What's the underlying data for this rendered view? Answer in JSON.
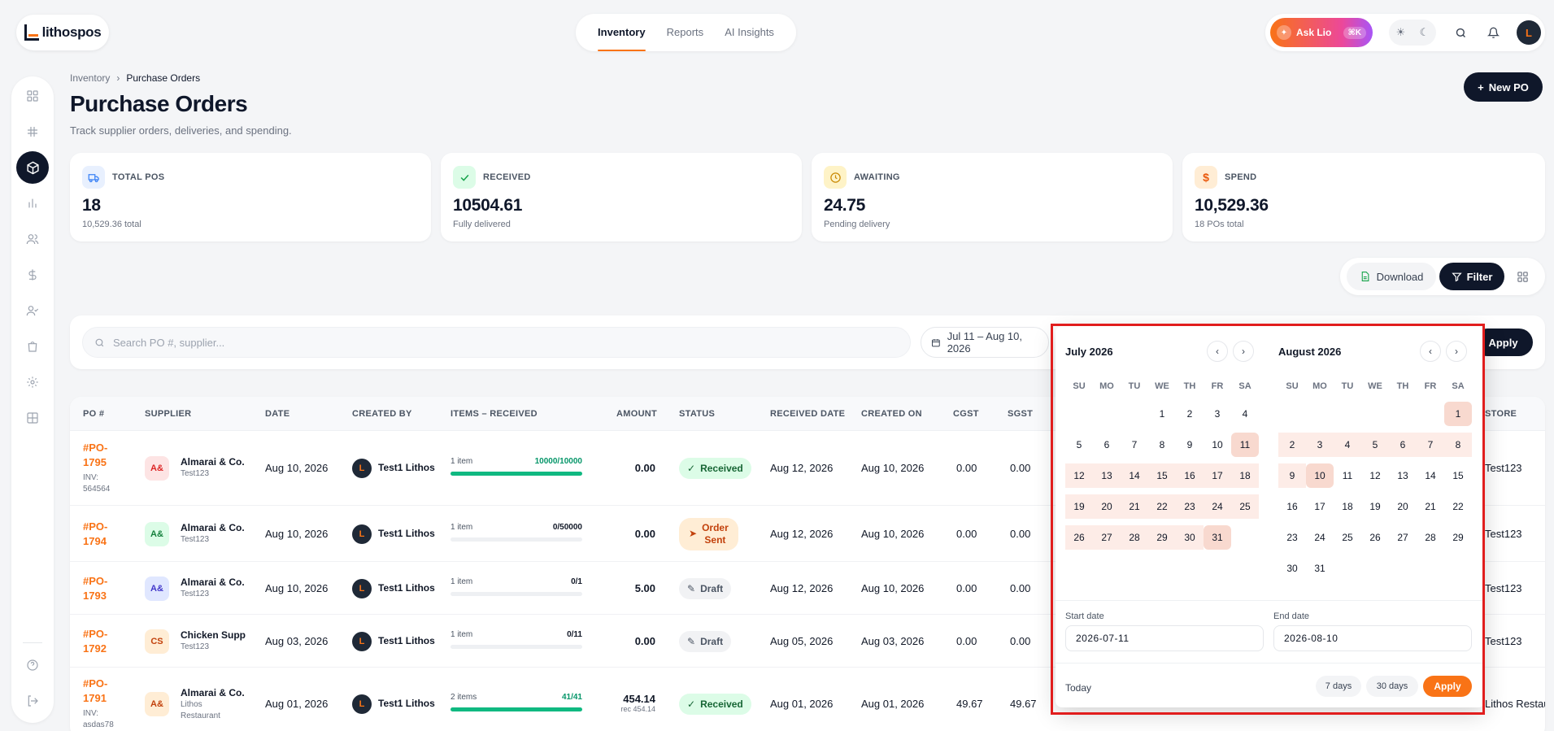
{
  "app": {
    "logo_text": "lithospos"
  },
  "topnav": {
    "tabs": [
      "Inventory",
      "Reports",
      "AI Insights"
    ],
    "active": "Inventory"
  },
  "header_right": {
    "ask_label": "Ask Lio",
    "ask_kbd": "⌘K",
    "avatar": "L"
  },
  "breadcrumb": {
    "parent": "Inventory",
    "current": "Purchase Orders"
  },
  "page": {
    "title": "Purchase Orders",
    "subtitle": "Track supplier orders, deliveries, and spending.",
    "new_button": "New PO"
  },
  "stats": [
    {
      "label": "TOTAL POS",
      "value": "18",
      "sub": "10,529.36 total",
      "icon": "truck-icon",
      "color": "#3b82f6",
      "bg": "#e8f0fe"
    },
    {
      "label": "RECEIVED",
      "value": "10504.61",
      "sub": "Fully delivered",
      "icon": "check-icon",
      "color": "#16a34a",
      "bg": "#dcfce7"
    },
    {
      "label": "AWAITING",
      "value": "24.75",
      "sub": "Pending delivery",
      "icon": "clock-icon",
      "color": "#ca8a04",
      "bg": "#fef3c7"
    },
    {
      "label": "SPEND",
      "value": "10,529.36",
      "sub": "18 POs total",
      "icon": "dollar-icon",
      "color": "#ea580c",
      "bg": "#ffedd5"
    }
  ],
  "actions": {
    "download": "Download",
    "filter": "Filter"
  },
  "search": {
    "placeholder": "Search PO #, supplier...",
    "date_range": "Jul 11 – Aug 10, 2026",
    "apply": "Apply"
  },
  "table": {
    "headers": [
      "PO #",
      "SUPPLIER",
      "DATE",
      "CREATED BY",
      "ITEMS – RECEIVED",
      "AMOUNT",
      "STATUS",
      "RECEIVED DATE",
      "CREATED ON",
      "CGST",
      "SGST",
      "STORE"
    ],
    "rows": [
      {
        "po1": "#PO-",
        "po2": "1795",
        "inv1": "INV:",
        "inv2": "564564",
        "sup_badge": "A&",
        "sup_color": "#fde4e4",
        "sup_text": "#dc2626",
        "supplier": "Almarai & Co.",
        "supplier_sub": "Test123",
        "supplier_sub2": "",
        "date": "Aug 10, 2026",
        "created_by": "Test1 Lithos",
        "items": "1 item",
        "received": "10000/10000",
        "progress": 1.0,
        "recv_green": true,
        "amount": "0.00",
        "amount_sub": "",
        "status": "Received",
        "status_type": "received",
        "received_date": "Aug 12, 2026",
        "created_on": "Aug 10, 2026",
        "cgst": "0.00",
        "sgst": "0.00",
        "store": "Test123"
      },
      {
        "po1": "#PO-",
        "po2": "1794",
        "inv1": "",
        "inv2": "",
        "sup_badge": "A&",
        "sup_color": "#dcfce7",
        "sup_text": "#15803d",
        "supplier": "Almarai & Co.",
        "supplier_sub": "Test123",
        "supplier_sub2": "",
        "date": "Aug 10, 2026",
        "created_by": "Test1 Lithos",
        "items": "1 item",
        "received": "0/50000",
        "progress": 0,
        "recv_green": false,
        "amount": "0.00",
        "amount_sub": "",
        "status": "Order Sent",
        "status_l1": "Order",
        "status_l2": "Sent",
        "status_type": "sent",
        "received_date": "Aug 12, 2026",
        "created_on": "Aug 10, 2026",
        "cgst": "0.00",
        "sgst": "0.00",
        "store": "Test123"
      },
      {
        "po1": "#PO-",
        "po2": "1793",
        "inv1": "",
        "inv2": "",
        "sup_badge": "A&",
        "sup_color": "#e0e7ff",
        "sup_text": "#4338ca",
        "supplier": "Almarai & Co.",
        "supplier_sub": "Test123",
        "supplier_sub2": "",
        "date": "Aug 10, 2026",
        "created_by": "Test1 Lithos",
        "items": "1 item",
        "received": "0/1",
        "progress": 0,
        "recv_green": false,
        "amount": "5.00",
        "amount_sub": "",
        "status": "Draft",
        "status_type": "draft",
        "received_date": "Aug 12, 2026",
        "created_on": "Aug 10, 2026",
        "cgst": "0.00",
        "sgst": "0.00",
        "store": "Test123"
      },
      {
        "po1": "#PO-",
        "po2": "1792",
        "inv1": "",
        "inv2": "",
        "sup_badge": "CS",
        "sup_color": "#ffedd5",
        "sup_text": "#c2410c",
        "supplier": "Chicken Supp",
        "supplier_sub": "Test123",
        "supplier_sub2": "",
        "date": "Aug 03, 2026",
        "created_by": "Test1 Lithos",
        "items": "1 item",
        "received": "0/11",
        "progress": 0,
        "recv_green": false,
        "amount": "0.00",
        "amount_sub": "",
        "status": "Draft",
        "status_type": "draft",
        "received_date": "Aug 05, 2026",
        "created_on": "Aug 03, 2026",
        "cgst": "0.00",
        "sgst": "0.00",
        "store": "Test123"
      },
      {
        "po1": "#PO-",
        "po2": "1791",
        "inv1": "INV:",
        "inv2": "asdas78",
        "sup_badge": "A&",
        "sup_color": "#ffedd5",
        "sup_text": "#c2410c",
        "supplier": "Almarai & Co.",
        "supplier_sub": "Lithos",
        "supplier_sub2": "Restaurant",
        "date": "Aug 01, 2026",
        "created_by": "Test1 Lithos",
        "items": "2 items",
        "received": "41/41",
        "progress": 1.0,
        "recv_green": true,
        "amount": "454.14",
        "amount_sub": "rec 454.14",
        "status": "Received",
        "status_type": "received",
        "received_date": "Aug 01, 2026",
        "created_on": "Aug 01, 2026",
        "cgst": "49.67",
        "sgst": "49.67",
        "store": "Lithos Restau"
      }
    ]
  },
  "calendar": {
    "months": [
      {
        "title": "July 2026",
        "first_dow": 3,
        "days": 31,
        "range_start": 11,
        "range_end": 31
      },
      {
        "title": "August 2026",
        "first_dow": 6,
        "days": 31,
        "range_start": 1,
        "range_end": 10
      }
    ],
    "dow": [
      "SU",
      "MO",
      "TU",
      "WE",
      "TH",
      "FR",
      "SA"
    ],
    "start_label": "Start date",
    "end_label": "End date",
    "start_value": "2026-07-11",
    "end_value": "2026-08-10",
    "today": "Today",
    "preset_7": "7 days",
    "preset_30": "30 days",
    "apply": "Apply"
  }
}
